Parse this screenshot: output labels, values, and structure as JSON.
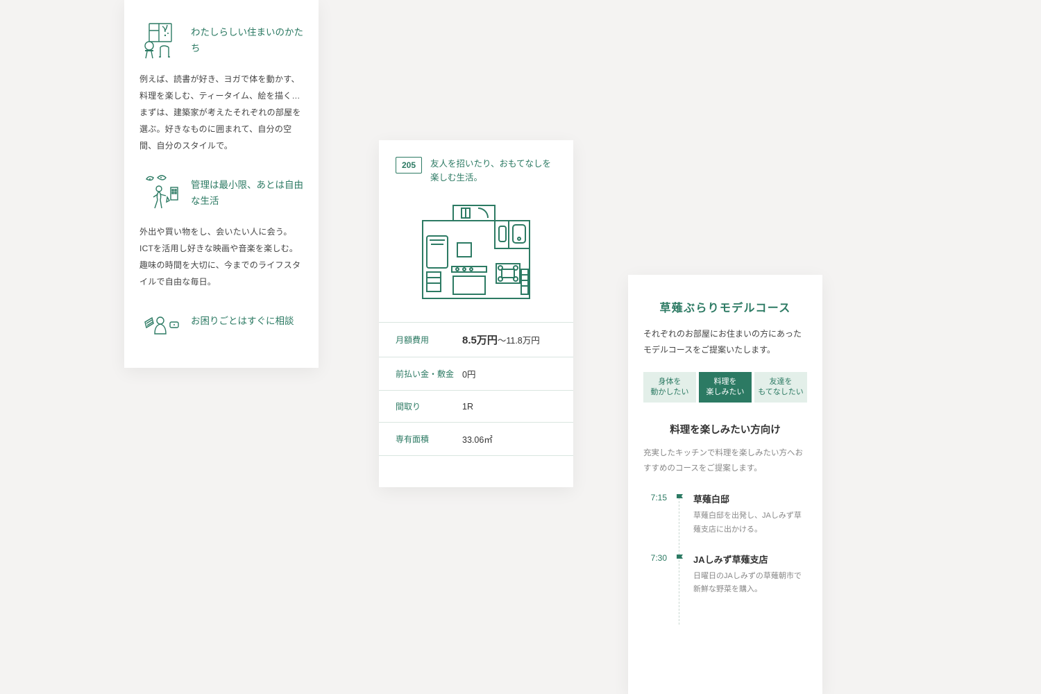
{
  "card1": {
    "sections": [
      {
        "title": "わたしらしい住まいのかたち",
        "body": "例えば、読書が好き、ヨガで体を動かす、料理を楽しむ、ティータイム、絵を描く…まずは、建築家が考えたそれぞれの部屋を選ぶ。好きなものに囲まれて、自分の空間、自分のスタイルで。"
      },
      {
        "title": "管理は最小限、あとは自由な生活",
        "body": "外出や買い物をし、会いたい人に会う。ICTを活用し好きな映画や音楽を楽しむ。趣味の時間を大切に、今までのライフスタイルで自由な毎日。"
      },
      {
        "title": "お困りごとはすぐに相談",
        "body": ""
      }
    ]
  },
  "card2": {
    "room_number": "205",
    "lead": "友人を招いたり、おもてなしを楽しむ生活。",
    "rows": [
      {
        "label": "月額費用",
        "value_em": "8.5万円",
        "value_tail": "〜11.8万円"
      },
      {
        "label": "前払い金・敷金",
        "value_em": "",
        "value_tail": "0円"
      },
      {
        "label": "間取り",
        "value_em": "",
        "value_tail": "1R"
      },
      {
        "label": "専有面積",
        "value_em": "",
        "value_tail": "33.06㎡"
      }
    ]
  },
  "card3": {
    "title": "草薙ぶらりモデルコース",
    "lead": "それぞれのお部屋にお住まいの方にあったモデルコースをご提案いたします。",
    "tabs": [
      {
        "label": "身体を\n動かしたい",
        "active": false
      },
      {
        "label": "料理を\n楽しみたい",
        "active": true
      },
      {
        "label": "友達を\nもてなしたい",
        "active": false
      }
    ],
    "sub_title": "料理を楽しみたい方向け",
    "sub_lead": "充実したキッチンで料理を楽しみたい方へおすすめのコースをご提案します。",
    "steps": [
      {
        "time": "7:15",
        "title": "草薙白邸",
        "desc": "草薙白邸を出発し、JAしみず草薙支店に出かける。"
      },
      {
        "time": "7:30",
        "title": "JAしみず草薙支店",
        "desc": "日曜日のJAしみずの草薙朝市で新鮮な野菜を購入。"
      }
    ]
  }
}
